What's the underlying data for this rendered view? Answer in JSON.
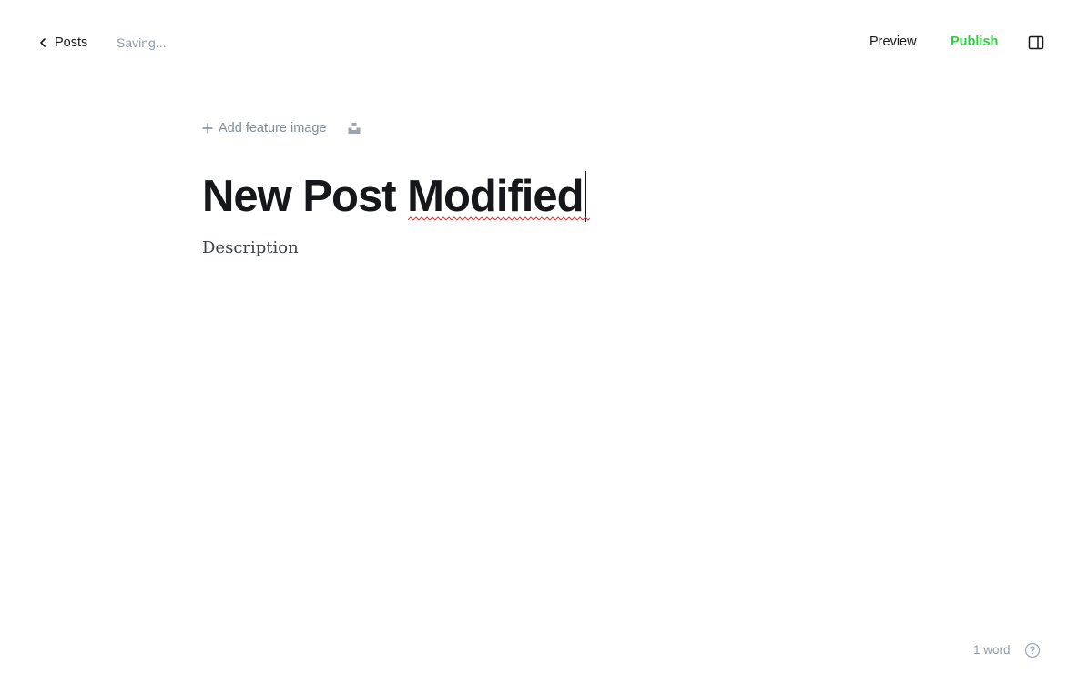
{
  "header": {
    "back_label": "Posts",
    "status": "Saving...",
    "preview_label": "Preview",
    "publish_label": "Publish",
    "publish_color": "#30cf43",
    "sidebar_toggle_icon": "sidebar-toggle-icon"
  },
  "editor": {
    "add_feature_image_label": "Add feature image",
    "unsplash_icon": "unsplash-icon",
    "title": "New Post Modified",
    "excerpt_placeholder": "Description"
  },
  "footer": {
    "word_count": "1 word",
    "help_icon": "question-circle-icon"
  }
}
